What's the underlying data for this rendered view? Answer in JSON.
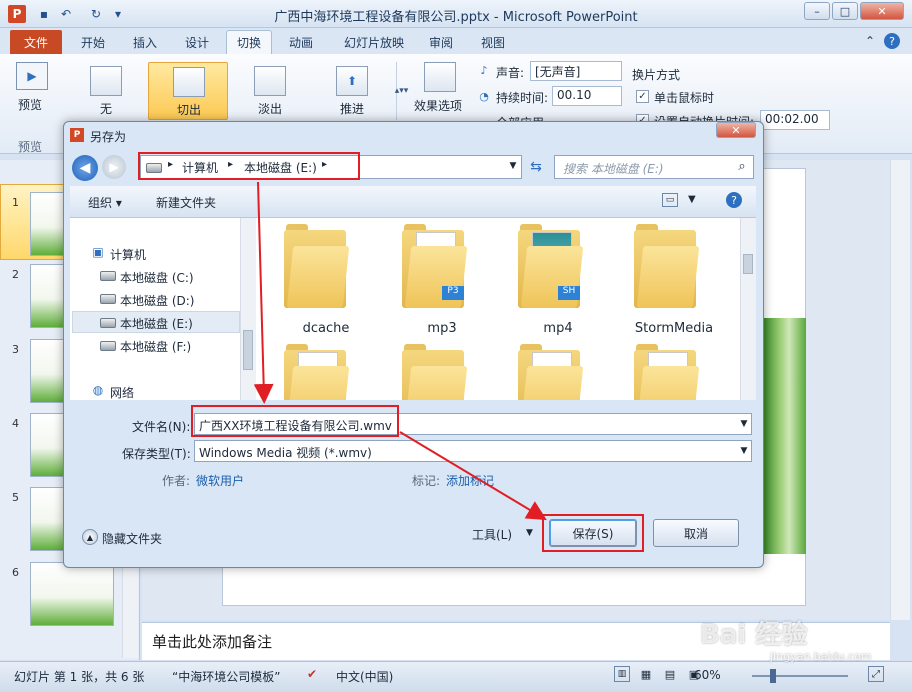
{
  "window": {
    "title": "广西中海环境工程设备有限公司.pptx - Microsoft PowerPoint",
    "app_icon_letter": "P"
  },
  "ribbon_tabs": [
    {
      "label": "文件"
    },
    {
      "label": "开始"
    },
    {
      "label": "插入"
    },
    {
      "label": "设计"
    },
    {
      "label": "切换"
    },
    {
      "label": "动画"
    },
    {
      "label": "幻灯片放映"
    },
    {
      "label": "审阅"
    },
    {
      "label": "视图"
    }
  ],
  "ribbon": {
    "preview_label": "预览",
    "preview_group": "预览",
    "transitions": [
      {
        "label": "无"
      },
      {
        "label": "切出"
      },
      {
        "label": "淡出"
      },
      {
        "label": "推进"
      }
    ],
    "effect_options": "效果选项",
    "sound_label": "声音:",
    "sound_value": "[无声音]",
    "duration_label": "持续时间:",
    "duration_value": "00.10",
    "apply_all": "全部应用",
    "advance_title": "换片方式",
    "on_click": "单击鼠标时",
    "after_time": "设置自动换片时间:",
    "after_time_value": "00:02.00"
  },
  "slides": [
    {
      "num": "1"
    },
    {
      "num": "2"
    },
    {
      "num": "3"
    },
    {
      "num": "4"
    },
    {
      "num": "5"
    },
    {
      "num": "6"
    }
  ],
  "notes_placeholder": "单击此处添加备注",
  "status": {
    "slide_info": "幻灯片 第 1 张，共 6 张",
    "theme": "“中海环境公司模板”",
    "language": "中文(中国)",
    "zoom": "60%"
  },
  "dialog": {
    "title": "另存为",
    "breadcrumb": [
      "计算机",
      "本地磁盘 (E:)"
    ],
    "search_placeholder": "搜索 本地磁盘 (E:)",
    "organize": "组织",
    "new_folder": "新建文件夹",
    "nav": {
      "computer": "计算机",
      "drives": [
        "本地磁盘 (C:)",
        "本地磁盘 (D:)",
        "本地磁盘 (E:)",
        "本地磁盘 (F:)"
      ],
      "network": "网络"
    },
    "folders": [
      {
        "name": "dcache",
        "label": ""
      },
      {
        "name": "mp3",
        "label": "P3"
      },
      {
        "name": "mp4",
        "label": "SH"
      },
      {
        "name": "StormMedia",
        "label": ""
      }
    ],
    "filename_label": "文件名(N):",
    "filename_value": "广西XX环境工程设备有限公司.wmv",
    "filetype_label": "保存类型(T):",
    "filetype_value": "Windows Media 视频 (*.wmv)",
    "author_label": "作者:",
    "author_value": "微软用户",
    "tags_label": "标记:",
    "tags_value": "添加标记",
    "hide_folders": "隐藏文件夹",
    "tools": "工具(L)",
    "save": "保存(S)",
    "cancel": "取消"
  },
  "watermark": {
    "brand": "Bai 经验",
    "url": "jingyan.baidu.com"
  },
  "colors": {
    "accent": "#d24726",
    "highlight": "#e01e24",
    "link": "#1b5fae"
  }
}
